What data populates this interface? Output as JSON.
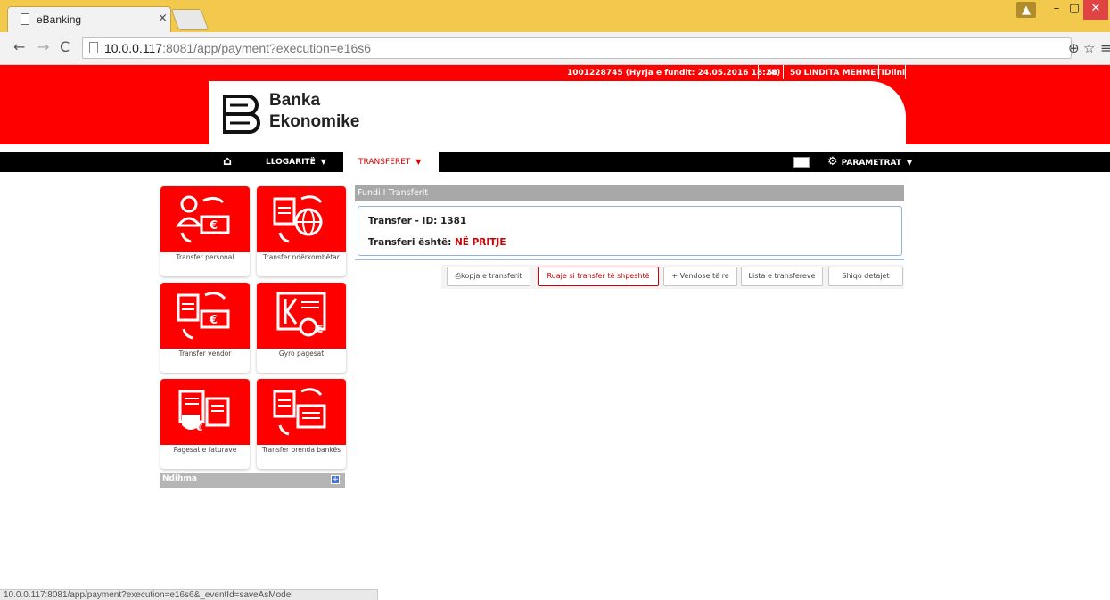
{
  "browser": {
    "tab_title": "eBanking",
    "tab_close": "×",
    "url_host": "10.0.0.117",
    "url_path": ":8081/app/payment?execution=e16s6",
    "status_url": "10.0.0.117:8081/app/payment?execution=e16s6&_eventId=saveAsModel"
  },
  "header": {
    "account_info": "1001228745  (Hyrja e fundit: 24.05.2016 18:28)",
    "code": "50",
    "user_name": "50 LINDITA MEHMETI",
    "logout": "Dilni",
    "logo_line1": "Banka",
    "logo_line2": "Ekonomike"
  },
  "nav": {
    "home_icon": "⌂",
    "accounts": "LLOGARITË",
    "transfers": "TRANSFERET",
    "settings": "PARAMETRAT",
    "caret": "▼"
  },
  "tiles": [
    {
      "label": "Transfer personal"
    },
    {
      "label": "Transfer ndërkombëtar"
    },
    {
      "label": "Transfer vendor"
    },
    {
      "label": "Gyro pagesat"
    },
    {
      "label": "Pagesat e faturave"
    },
    {
      "label": "Transfer brenda bankës"
    }
  ],
  "help": {
    "label": "Ndihma",
    "toggle": "+"
  },
  "panel": {
    "heading": "Fundi I Transferit",
    "transfer_id_label": "Transfer - ID: 1381",
    "status_label": "Transferi është:",
    "status_value": "NË PRITJE"
  },
  "actions": {
    "copy": "kopja e transferit",
    "save_quick": "Ruaje si transfer të shpeshtë",
    "new": "Vendose të re",
    "list": "Lista e transfereve",
    "details": "Shiqo detajet"
  },
  "colors": {
    "brand_red": "#ff0000",
    "status_red": "#cc0000"
  }
}
